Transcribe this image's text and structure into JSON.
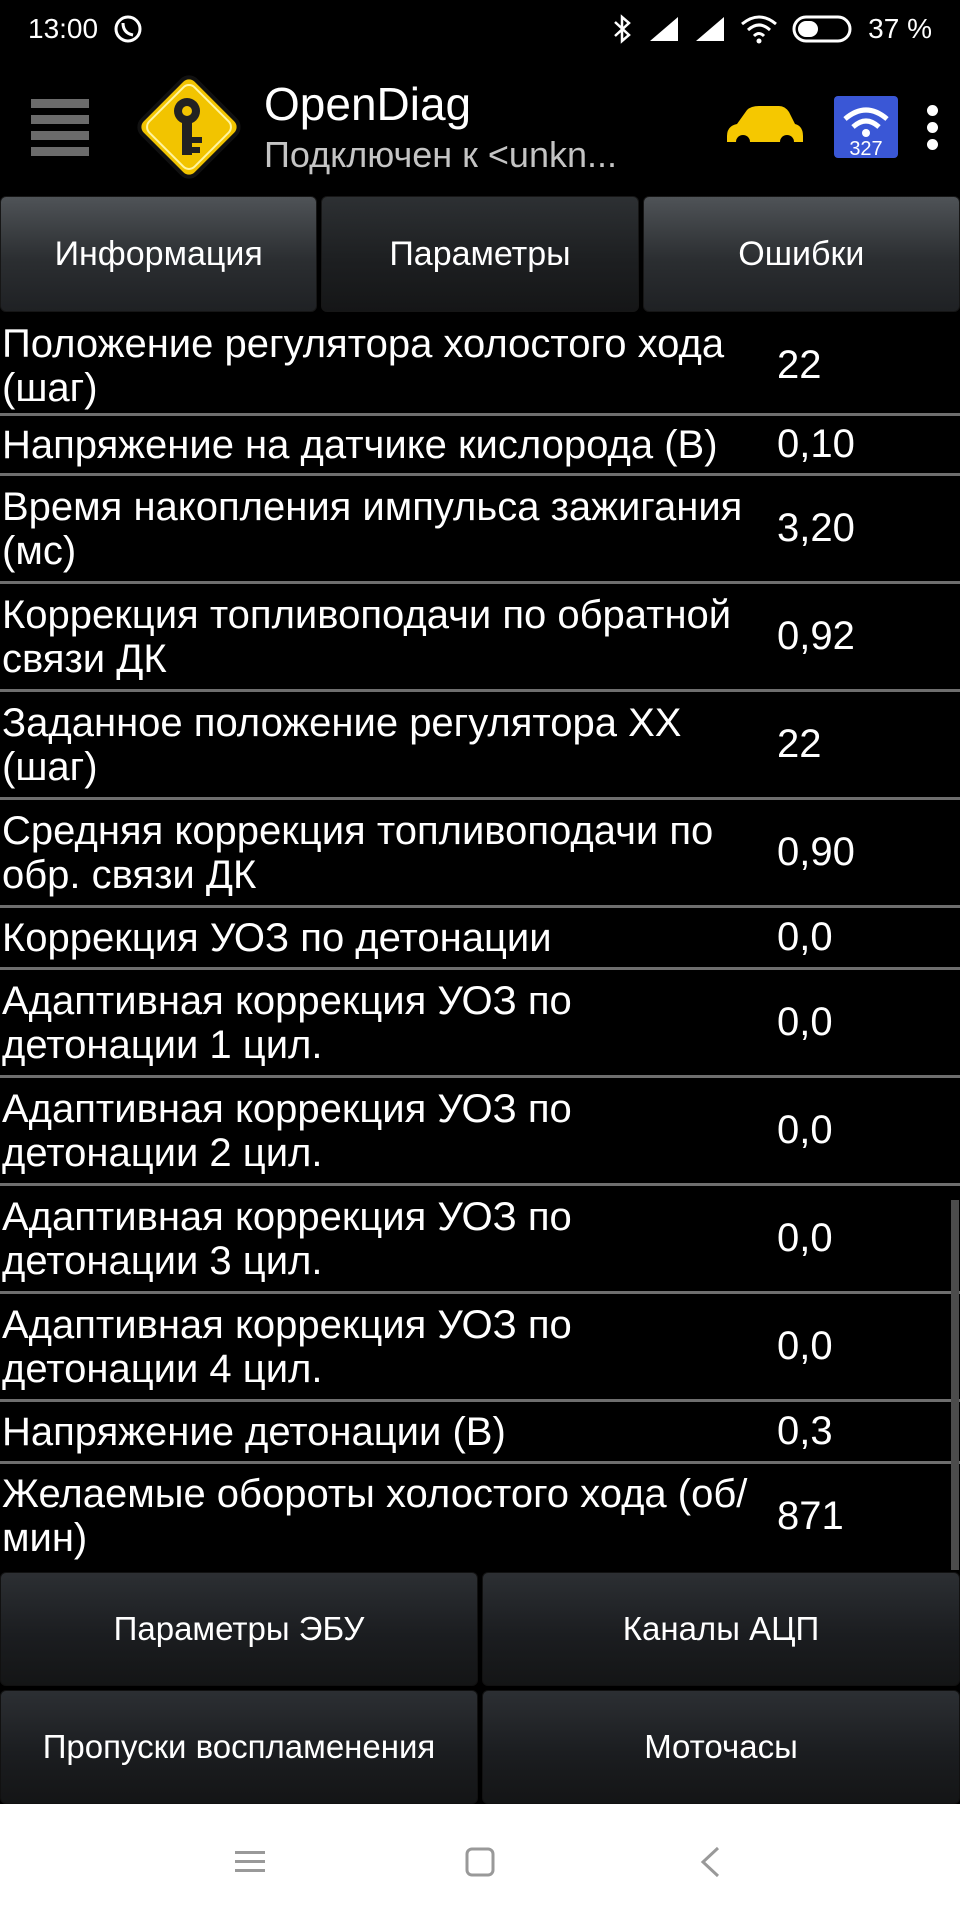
{
  "status_bar": {
    "time": "13:00",
    "battery": "37 %",
    "icons": [
      "viber-icon",
      "bluetooth-icon",
      "signal-icon",
      "signal-icon",
      "wifi-icon",
      "battery-icon"
    ]
  },
  "app_bar": {
    "title": "OpenDiag",
    "subtitle": "Подключен к <unkn...",
    "icons": [
      "hamburger-menu-icon",
      "key-logo-icon",
      "car-icon",
      "wifi-adapter-icon",
      "overflow-menu-icon"
    ],
    "adapter_badge": "327"
  },
  "tabs": [
    {
      "label": "Информация",
      "active": false
    },
    {
      "label": "Параметры",
      "active": true
    },
    {
      "label": "Ошибки",
      "active": false
    }
  ],
  "params": [
    {
      "label": "Положение регулятора холостого хода (шаг)",
      "value": "22"
    },
    {
      "label": "Напряжение на датчике кислорода (В)",
      "value": "0,10"
    },
    {
      "label": "Время накопления импульса зажигания (мс)",
      "value": "3,20"
    },
    {
      "label": "Коррекция топливоподачи по обратной связи ДК",
      "value": "0,92"
    },
    {
      "label": "Заданное положение регулятора ХХ (шаг)",
      "value": "22"
    },
    {
      "label": "Средняя коррекция топливоподачи по обр. связи ДК",
      "value": "0,90"
    },
    {
      "label": "Коррекция УОЗ по детонации",
      "value": "0,0"
    },
    {
      "label": "Адаптивная коррекция УОЗ по детонации 1 цил.",
      "value": "0,0"
    },
    {
      "label": "Адаптивная коррекция УОЗ по детонации 2 цил.",
      "value": "0,0"
    },
    {
      "label": "Адаптивная коррекция УОЗ по детонации 3 цил.",
      "value": "0,0"
    },
    {
      "label": "Адаптивная коррекция УОЗ по детонации 4 цил.",
      "value": "0,0"
    },
    {
      "label": "Напряжение детонации (В)",
      "value": "0,3"
    },
    {
      "label": "Желаемые обороты холостого хода (об/мин)",
      "value": "871"
    }
  ],
  "bottom_buttons": [
    {
      "label": "Параметры ЭБУ"
    },
    {
      "label": "Каналы АЦП"
    },
    {
      "label": "Пропуски воспламенения"
    },
    {
      "label": "Моточасы"
    }
  ],
  "nav_bar": {
    "icons": [
      "recents-icon",
      "home-icon",
      "back-icon"
    ]
  },
  "colors": {
    "background": "#000000",
    "divider": "#6e6e6e",
    "logo_yellow": "#f2c400",
    "car_yellow": "#f5c800",
    "adapter_blue": "#3a57d6"
  }
}
